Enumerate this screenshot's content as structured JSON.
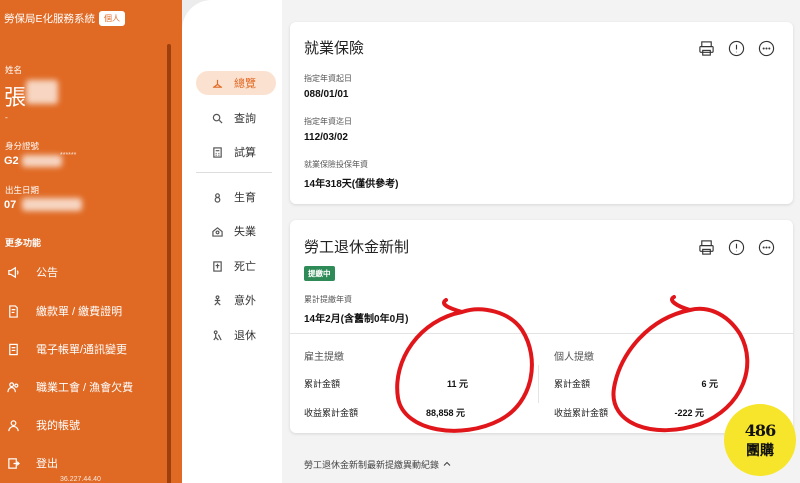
{
  "app": {
    "title": "勞保局E化服務系統",
    "badge": "個人"
  },
  "profile": {
    "name_label": "姓名",
    "name_value": "張",
    "name_suffix": "-",
    "id_label": "身分證號",
    "id_value": "G2",
    "id_mask": "******",
    "birth_label": "出生日期",
    "birth_value": "07"
  },
  "sidebar": {
    "section_title": "更多功能",
    "items": [
      {
        "label": "公告",
        "icon": "megaphone-icon"
      },
      {
        "label": "繳款單 / 繳費證明",
        "icon": "receipt-icon"
      },
      {
        "label": "電子帳單/通訊變更",
        "icon": "document-icon"
      },
      {
        "label": "職業工會 / 漁會欠費",
        "icon": "people-icon"
      },
      {
        "label": "我的帳號",
        "icon": "user-icon"
      },
      {
        "label": "登出",
        "icon": "logout-icon"
      }
    ],
    "bottom_text": "36.227.44.40"
  },
  "subnav": [
    {
      "label": "總覽",
      "icon": "overview-icon",
      "active": true
    },
    {
      "label": "查詢",
      "icon": "search-icon",
      "active": false
    },
    {
      "label": "試算",
      "icon": "calculator-icon",
      "active": false
    },
    {
      "label": "生育",
      "icon": "birth-icon",
      "active": false
    },
    {
      "label": "失業",
      "icon": "unemployment-icon",
      "active": false
    },
    {
      "label": "死亡",
      "icon": "death-icon",
      "active": false
    },
    {
      "label": "意外",
      "icon": "accident-icon",
      "active": false
    },
    {
      "label": "退休",
      "icon": "retirement-icon",
      "active": false
    }
  ],
  "employment_card": {
    "title": "就業保險",
    "start_label": "指定年資起日",
    "start_value": "088/01/01",
    "end_label": "指定年資迄日",
    "end_value": "112/03/02",
    "years_label": "就業保險投保年資",
    "years_value": "14年318天(僅供參考)"
  },
  "pension_card": {
    "title": "勞工退休金新制",
    "status": "提繳中",
    "years_label": "累計提繳年資",
    "years_value": "14年2月(含舊制0年0月)",
    "employer": {
      "title": "雇主提繳",
      "total_label": "累計金額",
      "total_value": "11 元",
      "profit_label": "收益累計金額",
      "profit_value": "88,858 元"
    },
    "personal": {
      "title": "個人提繳",
      "total_label": "累計金額",
      "total_value": "6 元",
      "profit_label": "收益累計金額",
      "profit_value": "-222 元"
    }
  },
  "footer": {
    "link": "勞工退休金新制最新提繳異動紀錄",
    "chevron": "chevron-up-icon"
  },
  "stamp": {
    "number": "486",
    "text": "團購"
  },
  "colors": {
    "brand": "#e06a24",
    "status": "#2e8b57",
    "annotation": "#e0161b",
    "stamp": "#f6e52a"
  }
}
